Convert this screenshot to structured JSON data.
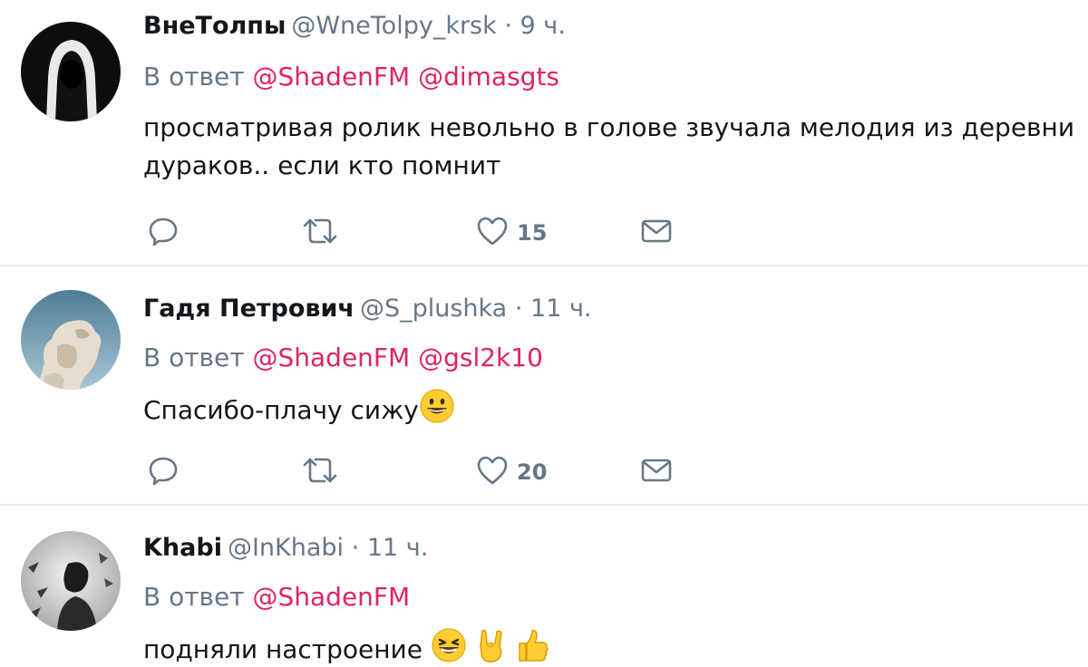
{
  "tweets": [
    {
      "display_name": "ВнеТолпы",
      "handle": "@WneTolpy_krsk",
      "separator": "·",
      "time": "9 ч.",
      "reply_prefix": "В ответ",
      "mentions": [
        "@ShadenFM",
        "@dimasgts"
      ],
      "text": "просматривая ролик  невольно в голове звучала мелодия из деревни дураков.. если кто помнит",
      "like_count": "15"
    },
    {
      "display_name": "Гадя Петрович",
      "handle": "@S_plushka",
      "separator": "·",
      "time": "11 ч.",
      "reply_prefix": "В ответ",
      "mentions": [
        "@ShadenFM",
        "@gsl2k10"
      ],
      "text": "Спасибо-плачу сижу",
      "like_count": "20"
    },
    {
      "display_name": "Khabi",
      "handle": "@InKhabi",
      "separator": "·",
      "time": "11 ч.",
      "reply_prefix": "В ответ",
      "mentions": [
        "@ShadenFM"
      ],
      "text": "подняли настроение"
    }
  ],
  "colors": {
    "mention": "#e0245e",
    "secondary_text": "#657786",
    "primary_text": "#14171a",
    "divider": "#e6ecf0"
  },
  "icons": {
    "reply": "speech-bubble-icon",
    "retweet": "retweet-arrows-icon",
    "like": "heart-outline-icon",
    "dm": "envelope-icon"
  }
}
